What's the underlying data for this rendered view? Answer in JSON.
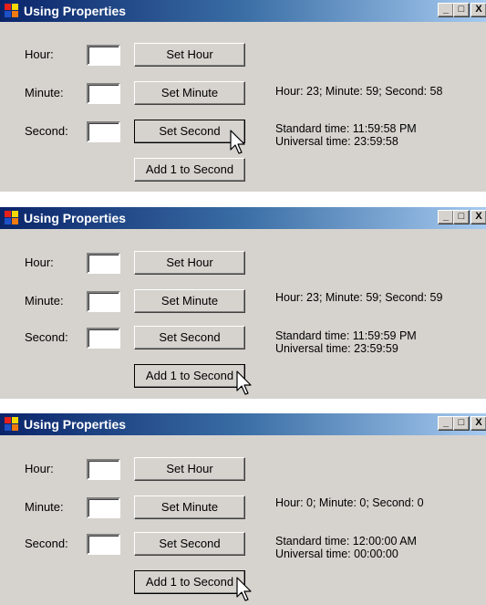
{
  "windows": [
    {
      "title": "Using Properties",
      "labels": {
        "hour": "Hour:",
        "minute": "Minute:",
        "second": "Second:"
      },
      "buttons": {
        "set_hour": "Set Hour",
        "set_minute": "Set Minute",
        "set_second": "Set Second",
        "add_second": "Add 1 to Second"
      },
      "time_display": "Hour: 23; Minute: 59; Second: 58",
      "standard_time": "Standard time: 11:59:58  PM",
      "universal_time": "Universal time: 23:59:58",
      "cursor_over": "Set Second"
    },
    {
      "title": "Using Properties",
      "labels": {
        "hour": "Hour:",
        "minute": "Minute:",
        "second": "Second:"
      },
      "buttons": {
        "set_hour": "Set Hour",
        "set_minute": "Set Minute",
        "set_second": "Set Second",
        "add_second": "Add 1 to Second"
      },
      "time_display": "Hour: 23; Minute: 59; Second: 59",
      "standard_time": "Standard time: 11:59:59  PM",
      "universal_time": "Universal time: 23:59:59",
      "cursor_over": "Add 1 to Second"
    },
    {
      "title": "Using Properties",
      "labels": {
        "hour": "Hour:",
        "minute": "Minute:",
        "second": "Second:"
      },
      "buttons": {
        "set_hour": "Set Hour",
        "set_minute": "Set Minute",
        "set_second": "Set Second",
        "add_second": "Add 1 to Second"
      },
      "time_display": "Hour: 0; Minute: 0; Second: 0",
      "standard_time": "Standard time: 12:00:00  AM",
      "universal_time": "Universal time: 00:00:00",
      "cursor_over": "Add 1 to Second"
    }
  ],
  "titlebar_buttons": {
    "minimize": "_",
    "maximize": "□",
    "close": "X"
  },
  "colors": {
    "window_bg": "#d6d3ce",
    "title_start": "#0a246a",
    "title_end": "#a6caf0"
  },
  "icons": {
    "app": "app-icon",
    "cursor": "pointer-cursor-icon"
  }
}
